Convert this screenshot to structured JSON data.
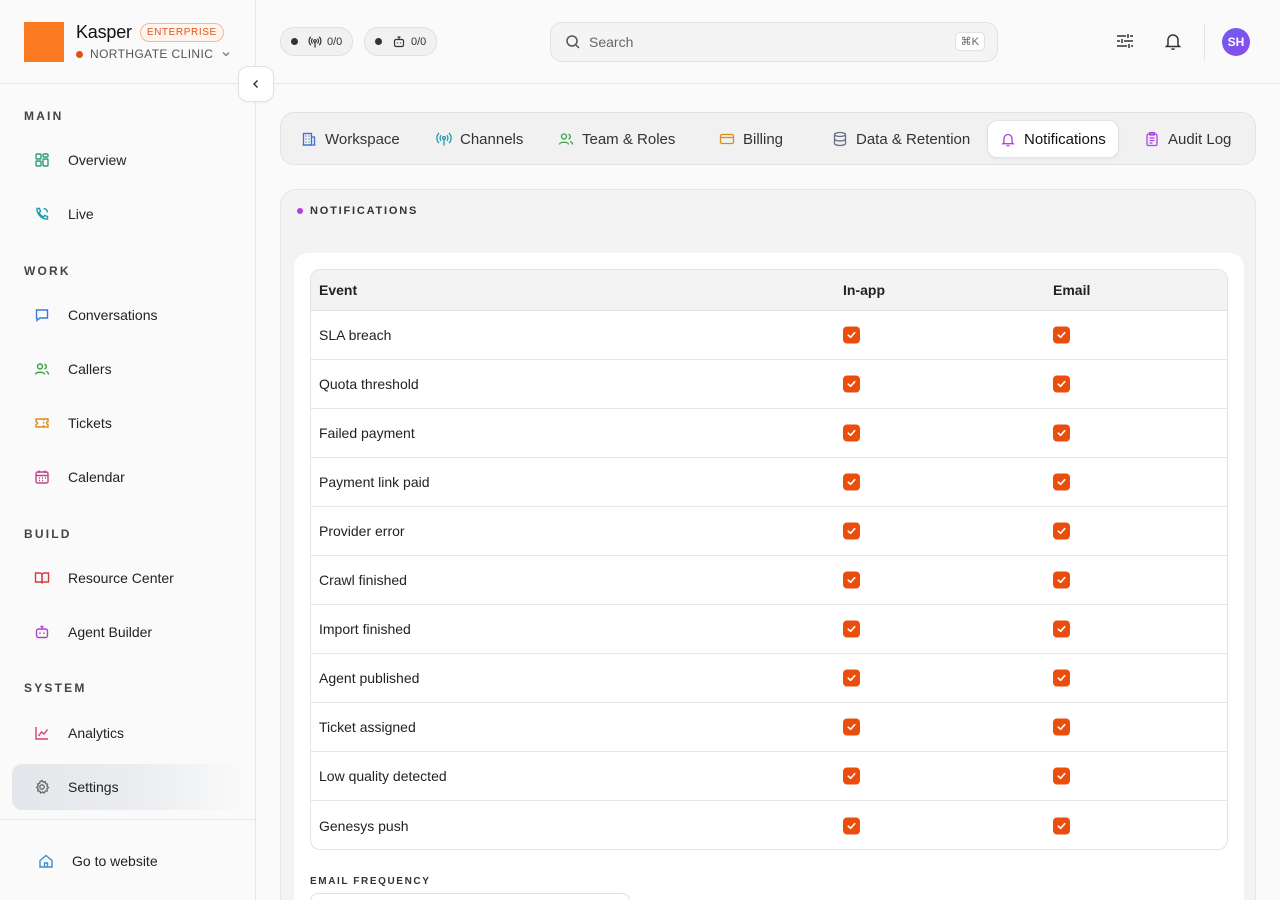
{
  "brand": {
    "name": "Kasper",
    "badge": "ENTERPRISE",
    "org": "NORTHGATE CLINIC"
  },
  "header": {
    "pills": [
      {
        "label": "0/0",
        "icon": "broadcast-icon"
      },
      {
        "label": "0/0",
        "icon": "bot-icon"
      }
    ],
    "search": {
      "placeholder": "Search",
      "shortcut": "⌘K"
    },
    "avatar": "SH"
  },
  "sidebar": {
    "sections": [
      {
        "title": "MAIN",
        "items": [
          {
            "label": "Overview",
            "icon": "grid-icon"
          },
          {
            "label": "Live",
            "icon": "phone-icon"
          }
        ]
      },
      {
        "title": "WORK",
        "items": [
          {
            "label": "Conversations",
            "icon": "chat-icon"
          },
          {
            "label": "Callers",
            "icon": "users-icon"
          },
          {
            "label": "Tickets",
            "icon": "ticket-icon"
          },
          {
            "label": "Calendar",
            "icon": "calendar-icon"
          }
        ]
      },
      {
        "title": "BUILD",
        "items": [
          {
            "label": "Resource Center",
            "icon": "book-icon"
          },
          {
            "label": "Agent Builder",
            "icon": "bot-icon"
          }
        ]
      },
      {
        "title": "SYSTEM",
        "items": [
          {
            "label": "Analytics",
            "icon": "chart-icon"
          },
          {
            "label": "Settings",
            "icon": "gear-icon",
            "active": true
          }
        ]
      }
    ],
    "footer": {
      "label": "Go to website",
      "icon": "home-icon"
    }
  },
  "tabs": [
    {
      "label": "Workspace",
      "icon": "building-icon"
    },
    {
      "label": "Channels",
      "icon": "broadcast-icon"
    },
    {
      "label": "Team & Roles",
      "icon": "users-icon"
    },
    {
      "label": "Billing",
      "icon": "card-icon"
    },
    {
      "label": "Data & Retention",
      "icon": "database-icon"
    },
    {
      "label": "Notifications",
      "icon": "bell-icon",
      "active": true
    },
    {
      "label": "Audit Log",
      "icon": "clipboard-icon"
    }
  ],
  "panel": {
    "title": "NOTIFICATIONS",
    "table": {
      "headers": {
        "event": "Event",
        "inapp": "In-app",
        "email": "Email"
      },
      "rows": [
        {
          "event": "SLA breach",
          "inapp": true,
          "email": true
        },
        {
          "event": "Quota threshold",
          "inapp": true,
          "email": true
        },
        {
          "event": "Failed payment",
          "inapp": true,
          "email": true
        },
        {
          "event": "Payment link paid",
          "inapp": true,
          "email": true
        },
        {
          "event": "Provider error",
          "inapp": true,
          "email": true
        },
        {
          "event": "Crawl finished",
          "inapp": true,
          "email": true
        },
        {
          "event": "Import finished",
          "inapp": true,
          "email": true
        },
        {
          "event": "Agent published",
          "inapp": true,
          "email": true
        },
        {
          "event": "Ticket assigned",
          "inapp": true,
          "email": true
        },
        {
          "event": "Low quality detected",
          "inapp": true,
          "email": true
        },
        {
          "event": "Genesys push",
          "inapp": true,
          "email": true
        }
      ]
    },
    "email_frequency_label": "EMAIL FREQUENCY"
  },
  "colors": {
    "accent": "#ea4d0c",
    "logo": "#fb7a21",
    "avatar": "#7a52ee"
  }
}
